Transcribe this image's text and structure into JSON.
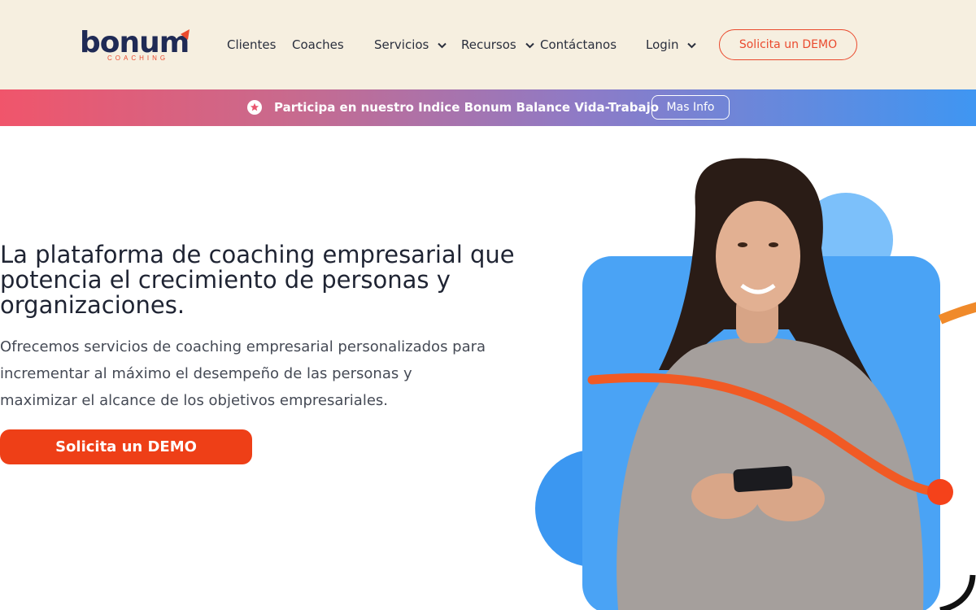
{
  "header": {
    "logo_text": "bonum",
    "logo_subtext": "COACHING",
    "nav": {
      "clientes": "Clientes",
      "coaches": "Coaches",
      "servicios": "Servicios",
      "recursos": "Recursos",
      "contactanos": "Contáctanos",
      "login": "Login"
    },
    "demo_button": "Solicita un DEMO"
  },
  "banner": {
    "text": "Participa en nuestro Indice Bonum Balance Vida-Trabajo",
    "button": "Mas Info",
    "icon": "star-circle-icon"
  },
  "hero": {
    "title": "La plataforma de coaching empresarial que potencia el crecimiento de personas y organizaciones.",
    "description": "Ofrecemos servicios de coaching empresarial personalizados para incrementar al máximo el desempeño de las personas y maximizar el alcance de los objetivos empresariales.",
    "cta": "Solicita un DEMO"
  },
  "colors": {
    "header_bg": "#f6efe0",
    "brand_navy": "#1f2a55",
    "accent_orange": "#ee3f17",
    "banner_start": "#f0556b",
    "banner_end": "#3f96f2",
    "art_blue": "#4aa3f5"
  }
}
